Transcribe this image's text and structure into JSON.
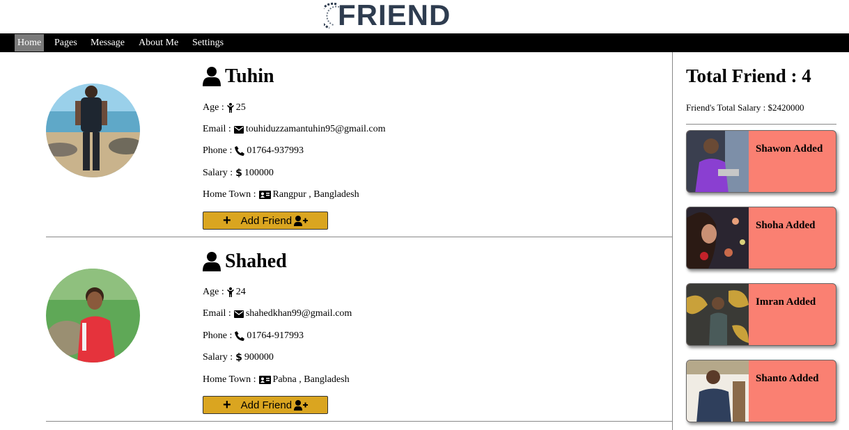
{
  "brand": {
    "logo_text": "FRIEND"
  },
  "nav": {
    "items": [
      {
        "label": "Home",
        "active": true
      },
      {
        "label": "Pages",
        "active": false
      },
      {
        "label": "Message",
        "active": false
      },
      {
        "label": "About Me",
        "active": false
      },
      {
        "label": "Settings",
        "active": false
      }
    ]
  },
  "friends": [
    {
      "name": "Tuhin",
      "age_label": "Age :",
      "age": "25",
      "email_label": "Email :",
      "email": "touhiduzzamantuhin95@gmail.com",
      "phone_label": "Phone :",
      "phone": "01764-937993",
      "salary_label": "Salary :",
      "salary": "100000",
      "hometown_label": "Home Town :",
      "hometown": "Rangpur , Bangladesh",
      "button_label": "Add Friend"
    },
    {
      "name": "Shahed",
      "age_label": "Age :",
      "age": "24",
      "email_label": "Email :",
      "email": "shahedkhan99@gmail.com",
      "phone_label": "Phone :",
      "phone": "01764-917993",
      "salary_label": "Salary :",
      "salary": "900000",
      "hometown_label": "Home Town :",
      "hometown": "Pabna , Bangladesh",
      "button_label": "Add Friend"
    }
  ],
  "sidebar": {
    "total_title": "Total Friend : 4",
    "total_salary": "Friend's Total Salary : $2420000",
    "added": [
      {
        "label": "Shawon Added"
      },
      {
        "label": "Shoha Added"
      },
      {
        "label": "Imran Added"
      },
      {
        "label": "Shanto Added"
      }
    ]
  },
  "colors": {
    "nav_bg": "#000000",
    "nav_active": "#7a7a7a",
    "button": "#daa520",
    "added_card": "#fa8072",
    "logo": "#2e3c4f"
  }
}
